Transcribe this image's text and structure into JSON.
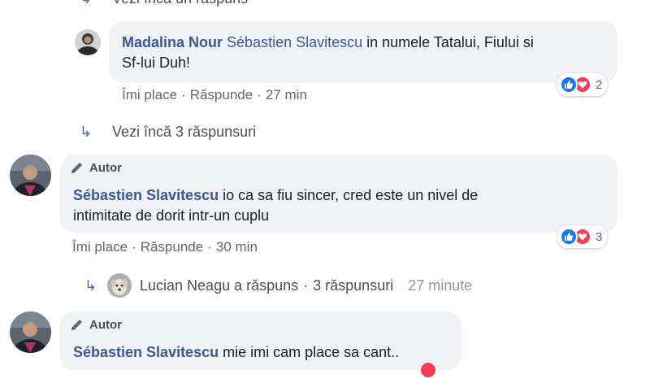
{
  "top_reply_link": {
    "arrow": "↳",
    "label": "Vezi încă un răspuns"
  },
  "comment1": {
    "author": "Madalina Nour",
    "mention": "Sébastien Slavitescu",
    "text_line1": " in numele Tatalui, Fiului si",
    "text_line2": "Sf-lui Duh!",
    "like": "Îmi place",
    "reply": "Răspunde",
    "time": "27 min",
    "reaction_count": "2",
    "sep": "·"
  },
  "more_replies_1": {
    "arrow": "↳",
    "label": "Vezi încă 3 răspunsuri"
  },
  "comment2": {
    "badge": "Autor",
    "author": "Sébastien Slavitescu",
    "text_line1": " io ca sa fiu sincer, cred este un nivel de",
    "text_line2": "intimitate de dorit intr-un cuplu",
    "like": "Îmi place",
    "reply": "Răspunde",
    "time": "30 min",
    "reaction_count": "3",
    "sep": "·"
  },
  "lucian_reply": {
    "arrow": "↳",
    "name_text": "Lucian Neagu a răspuns",
    "sep": "·",
    "count_text": "3 răspunsuri",
    "time": "27 minute"
  },
  "comment3": {
    "badge": "Autor",
    "author": "Sébastien Slavitescu",
    "text": " mie imi cam place sa cant.."
  },
  "colors": {
    "link": "#385898",
    "bubble": "#f0f2f5",
    "like": "#1877f2",
    "love": "#f33e58"
  },
  "icons": [
    "reply-arrow-icon",
    "pencil-icon",
    "like-icon",
    "love-icon"
  ]
}
